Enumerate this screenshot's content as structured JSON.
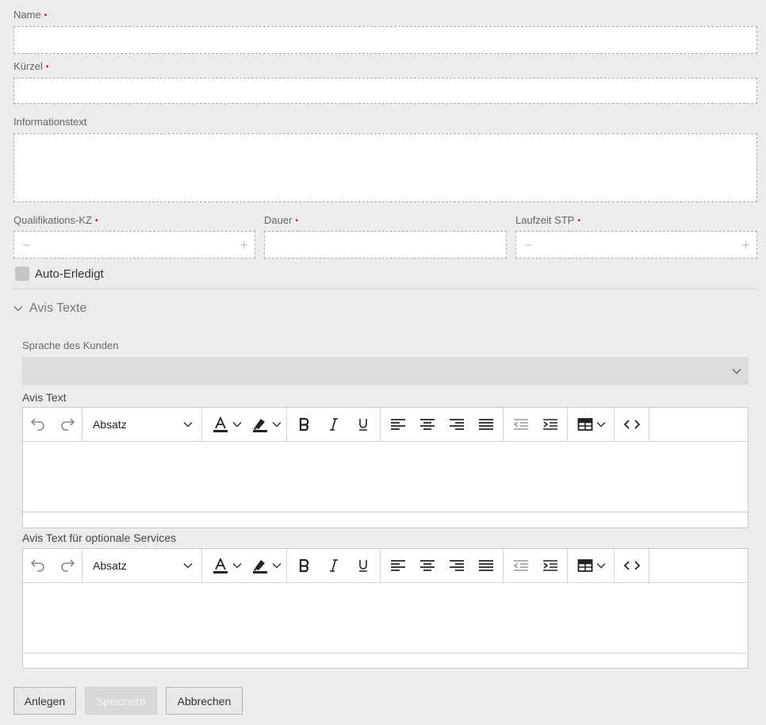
{
  "form": {
    "name_label": "Name",
    "kuerzel_label": "Kürzel",
    "info_label": "Informationstext",
    "qual_label": "Qualifikations-KZ",
    "dauer_label": "Dauer",
    "laufzeit_label": "Laufzeit STP",
    "required_mark": "•",
    "stepper_minus": "−",
    "stepper_plus": "+",
    "auto_label": "Auto-Erledigt"
  },
  "avis": {
    "section_title": "Avis Texte",
    "sprache_label": "Sprache des Kunden",
    "sprache_value": "",
    "editor1_label": "Avis Text",
    "editor2_label": "Avis Text für optionale Services",
    "block_format": "Absatz"
  },
  "buttons": {
    "anlegen": "Anlegen",
    "speichern": "Speichern",
    "abbrechen": "Abbrechen"
  }
}
